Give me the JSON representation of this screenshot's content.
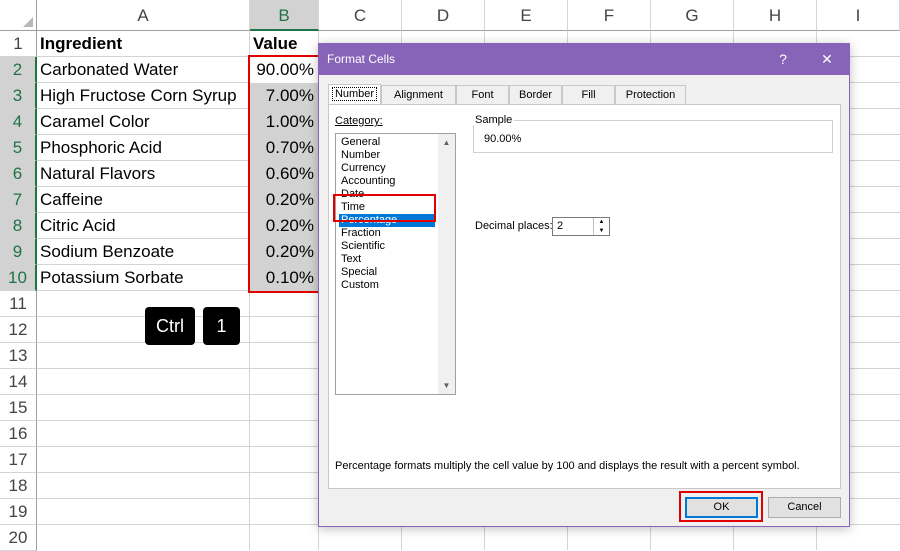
{
  "spreadsheet": {
    "columns": [
      "A",
      "B",
      "C",
      "D",
      "E",
      "F",
      "G",
      "H",
      "I"
    ],
    "rows": [
      "1",
      "2",
      "3",
      "4",
      "5",
      "6",
      "7",
      "8",
      "9",
      "10",
      "11",
      "12",
      "13",
      "14",
      "15",
      "16",
      "17",
      "18",
      "19",
      "20"
    ],
    "header": {
      "ingredient": "Ingredient",
      "value": "Value"
    },
    "data": [
      {
        "ingredient": "Carbonated Water",
        "value": "90.00%"
      },
      {
        "ingredient": "High Fructose Corn Syrup",
        "value": "7.00%"
      },
      {
        "ingredient": "Caramel Color",
        "value": "1.00%"
      },
      {
        "ingredient": "Phosphoric Acid",
        "value": "0.70%"
      },
      {
        "ingredient": "Natural Flavors",
        "value": "0.60%"
      },
      {
        "ingredient": "Caffeine",
        "value": "0.20%"
      },
      {
        "ingredient": "Citric Acid",
        "value": "0.20%"
      },
      {
        "ingredient": "Sodium Benzoate",
        "value": "0.20%"
      },
      {
        "ingredient": "Potassium Sorbate",
        "value": "0.10%"
      }
    ]
  },
  "shortcut": {
    "key1": "Ctrl",
    "key2": "1"
  },
  "dialog": {
    "title": "Format Cells",
    "help": "?",
    "close": "✕",
    "tabs": [
      "Number",
      "Alignment",
      "Font",
      "Border",
      "Fill",
      "Protection"
    ],
    "category_label": "Category:",
    "categories": [
      "General",
      "Number",
      "Currency",
      "Accounting",
      "Date",
      "Time",
      "Percentage",
      "Fraction",
      "Scientific",
      "Text",
      "Special",
      "Custom"
    ],
    "selected_category": "Percentage",
    "sample_label": "Sample",
    "sample_value": "90.00%",
    "decimal_label": "Decimal places:",
    "decimal_value": "2",
    "description": "Percentage formats multiply the cell value by 100 and displays the result with a percent symbol.",
    "ok_label": "OK",
    "cancel_label": "Cancel"
  },
  "colors": {
    "title_bar": "#8764b8",
    "highlight": "#e00000",
    "selection": "#0078d7",
    "excel_green": "#217346"
  }
}
